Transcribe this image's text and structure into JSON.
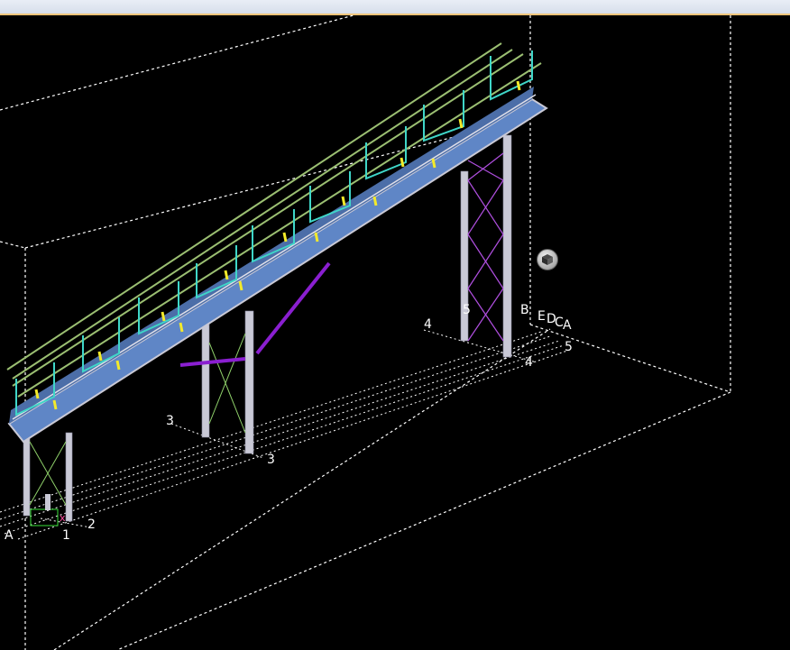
{
  "app": {
    "view": "3D model view - conveyor bridge"
  },
  "grid_labels": {
    "row_letters": [
      "B",
      "E",
      "D",
      "C",
      "A"
    ],
    "left_letter": "A",
    "axis_numbers": [
      "1",
      "2",
      "3",
      "3",
      "4",
      "4",
      "5",
      "5"
    ]
  },
  "icons": {
    "view_cube": "cube-icon",
    "axis_marker": "axis-triad-icon"
  },
  "colors": {
    "background": "#000000",
    "walkway": "#5f86c6",
    "handrail": "#9bbf72",
    "frame_cyan": "#3fd6c8",
    "stair_yellow": "#f3ea2a",
    "column_grey": "#c9c9d6",
    "bracing_purple": "#9d3fd6",
    "grid_white": "#ffffff"
  }
}
